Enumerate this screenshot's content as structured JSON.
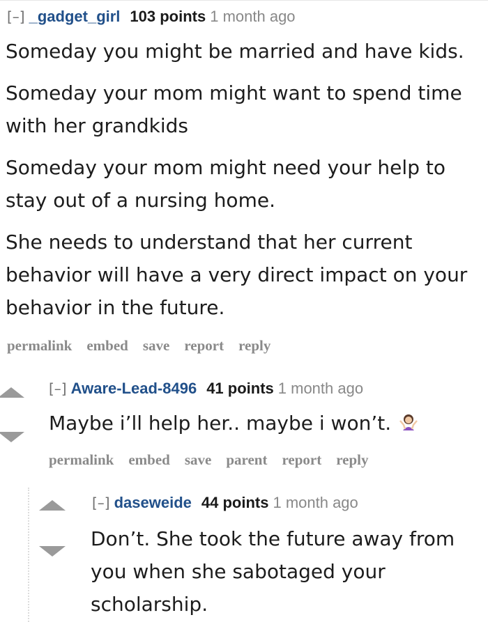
{
  "comments": [
    {
      "toggle": "[–]",
      "author": "_gadget_girl",
      "points": "103 points",
      "age": "1 month ago",
      "paragraphs": [
        "Someday you might be married and have kids.",
        "Someday your mom might want to spend time with her grandkids",
        "Someday your mom might need your help to stay out of a nursing home.",
        "She needs to understand that her current behavior will have a very direct impact on your behavior in the future."
      ],
      "actions": [
        "permalink",
        "embed",
        "save",
        "report",
        "reply"
      ]
    },
    {
      "toggle": "[–]",
      "author": "Aware-Lead-8496",
      "points": "41 points",
      "age": "1 month ago",
      "text": "Maybe i’ll help her.. maybe i won’t.",
      "emoji": "person-shrugging-emoji",
      "actions": [
        "permalink",
        "embed",
        "save",
        "parent",
        "report",
        "reply"
      ]
    },
    {
      "toggle": "[–]",
      "author": "daseweide",
      "points": "44 points",
      "age": "1 month ago",
      "text": "Don’t. She took the future away from you when she sabotaged your scholarship."
    }
  ],
  "colors": {
    "author": "#21508a",
    "muted": "#888888",
    "arrow": "#9a9a9a",
    "text": "#1c1c1c"
  }
}
